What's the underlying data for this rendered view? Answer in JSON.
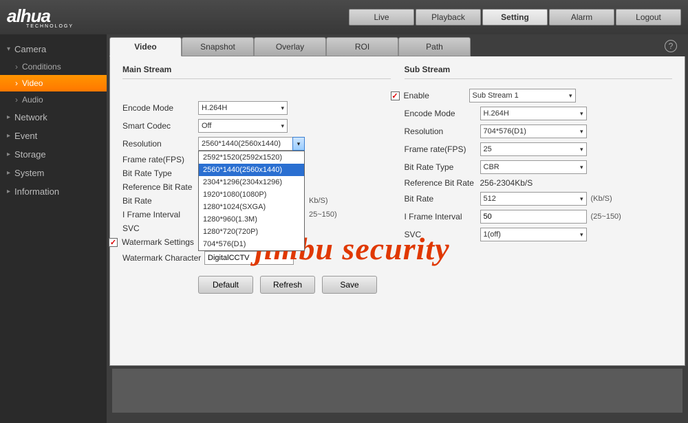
{
  "logo": {
    "text": "alhua",
    "sub": "TECHNOLOGY"
  },
  "top_nav": [
    "Live",
    "Playback",
    "Setting",
    "Alarm",
    "Logout"
  ],
  "top_nav_active": 2,
  "sidebar": {
    "camera": {
      "label": "Camera",
      "items": [
        "Conditions",
        "Video",
        "Audio"
      ],
      "active": 1
    },
    "groups": [
      "Network",
      "Event",
      "Storage",
      "System",
      "Information"
    ]
  },
  "tabs": [
    "Video",
    "Snapshot",
    "Overlay",
    "ROI",
    "Path"
  ],
  "tabs_active": 0,
  "main_stream": {
    "title": "Main Stream",
    "encode_mode": {
      "label": "Encode Mode",
      "value": "H.264H"
    },
    "smart_codec": {
      "label": "Smart Codec",
      "value": "Off"
    },
    "resolution": {
      "label": "Resolution",
      "value": "2560*1440(2560x1440)"
    },
    "frame_rate": {
      "label": "Frame rate(FPS)"
    },
    "bit_rate_type": {
      "label": "Bit Rate Type"
    },
    "ref_bit_rate": {
      "label": "Reference Bit Rate"
    },
    "bit_rate": {
      "label": "Bit Rate",
      "suffix": "Kb/S)"
    },
    "iframe": {
      "label": "I Frame Interval",
      "suffix": "25~150)"
    },
    "svc": {
      "label": "SVC"
    },
    "watermark_settings": {
      "label": "Watermark Settings"
    },
    "watermark_char": {
      "label": "Watermark Character",
      "value": "DigitalCCTV"
    },
    "resolution_options": [
      "2592*1520(2592x1520)",
      "2560*1440(2560x1440)",
      "2304*1296(2304x1296)",
      "1920*1080(1080P)",
      "1280*1024(SXGA)",
      "1280*960(1.3M)",
      "1280*720(720P)",
      "704*576(D1)"
    ],
    "resolution_selected": 1
  },
  "sub_stream": {
    "title": "Sub Stream",
    "enable": {
      "label": "Enable",
      "value": "Sub Stream 1"
    },
    "encode_mode": {
      "label": "Encode Mode",
      "value": "H.264H"
    },
    "resolution": {
      "label": "Resolution",
      "value": "704*576(D1)"
    },
    "frame_rate": {
      "label": "Frame rate(FPS)",
      "value": "25"
    },
    "bit_rate_type": {
      "label": "Bit Rate Type",
      "value": "CBR"
    },
    "ref_bit_rate": {
      "label": "Reference Bit Rate",
      "value": "256-2304Kb/S"
    },
    "bit_rate": {
      "label": "Bit Rate",
      "value": "512",
      "suffix": "(Kb/S)"
    },
    "iframe": {
      "label": "I Frame Interval",
      "value": "50",
      "suffix": "(25~150)"
    },
    "svc": {
      "label": "SVC",
      "value": "1(off)"
    }
  },
  "buttons": {
    "default": "Default",
    "refresh": "Refresh",
    "save": "Save"
  },
  "watermark_overlay": "jimbu security"
}
